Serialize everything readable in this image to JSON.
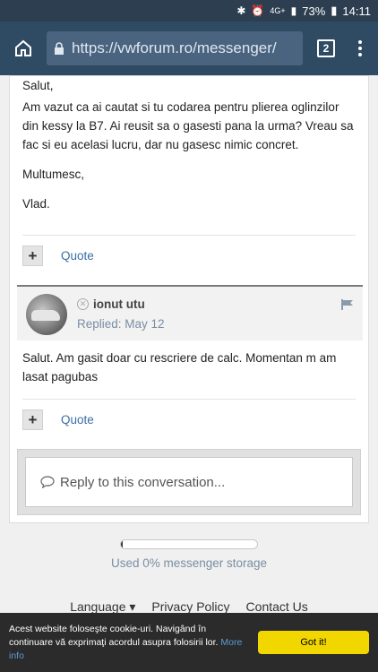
{
  "status_bar": {
    "signal": "4G+",
    "battery": "73%",
    "time": "14:11"
  },
  "browser": {
    "url": "https://vwforum.ro/messenger/",
    "tab_count": "2"
  },
  "message1": {
    "greeting": "Salut,",
    "body": "Am vazut ca ai cautat si tu codarea pentru plierea oglinzilor din kessy la B7. Ai reusit sa o gasesti pana la urma? Vreau sa fac si eu acelasi lucru, dar nu gasesc nimic concret.",
    "thanks": "Multumesc,",
    "signature": "Vlad."
  },
  "actions": {
    "plus_label": "+",
    "quote_label": "Quote"
  },
  "message2": {
    "author": "ionut utu",
    "replied": "Replied: May 12",
    "body": "Salut. Am gasit doar cu rescriere de calc. Momentan m am lasat pagubas"
  },
  "reply": {
    "placeholder": "Reply to this conversation..."
  },
  "storage": {
    "used_fraction": 0.01,
    "label": "Used 0% messenger storage"
  },
  "footer": {
    "language": "Language",
    "privacy": "Privacy Policy",
    "contact": "Contact Us"
  },
  "cookie": {
    "text": "Acest website foloseşte cookie-uri. Navigând în continuare vă exprimaţi acordul asupra folosirii lor.",
    "more": "More info",
    "button": "Got it!"
  },
  "colors": {
    "accent": "#3a6ea5",
    "toolbar": "#2f4a63",
    "cookie_button": "#f1d600"
  }
}
